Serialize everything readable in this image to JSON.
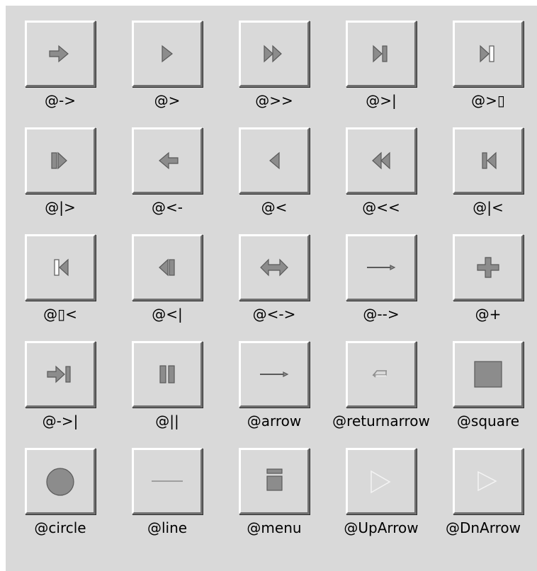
{
  "bitmaps": [
    {
      "label": "@->",
      "icon": "arrow-right-icon"
    },
    {
      "label": "@>",
      "icon": "play-icon"
    },
    {
      "label": "@>>",
      "icon": "fast-forward-icon"
    },
    {
      "label": "@>|",
      "icon": "skip-to-end-icon"
    },
    {
      "label": "@>▯",
      "icon": "skip-to-end-hollow-icon"
    },
    {
      "label": "@|>",
      "icon": "step-forward-icon"
    },
    {
      "label": "@<-",
      "icon": "arrow-left-icon"
    },
    {
      "label": "@<",
      "icon": "play-back-icon"
    },
    {
      "label": "@<<",
      "icon": "rewind-icon"
    },
    {
      "label": "@|<",
      "icon": "skip-to-start-icon"
    },
    {
      "label": "@▯<",
      "icon": "skip-to-start-hollow-icon"
    },
    {
      "label": "@<|",
      "icon": "step-back-icon"
    },
    {
      "label": "@<->",
      "icon": "double-arrow-icon"
    },
    {
      "label": "@-->",
      "icon": "thin-arrow-icon"
    },
    {
      "label": "@+",
      "icon": "plus-icon"
    },
    {
      "label": "@->|",
      "icon": "arrow-to-bar-icon"
    },
    {
      "label": "@||",
      "icon": "pause-icon"
    },
    {
      "label": "@arrow",
      "icon": "thin-arrow-icon"
    },
    {
      "label": "@returnarrow",
      "icon": "return-arrow-icon"
    },
    {
      "label": "@square",
      "icon": "square-icon"
    },
    {
      "label": "@circle",
      "icon": "circle-icon"
    },
    {
      "label": "@line",
      "icon": "line-icon"
    },
    {
      "label": "@menu",
      "icon": "menu-icon"
    },
    {
      "label": "@UpArrow",
      "icon": "up-arrow-icon"
    },
    {
      "label": "@DnArrow",
      "icon": "down-arrow-icon"
    }
  ]
}
